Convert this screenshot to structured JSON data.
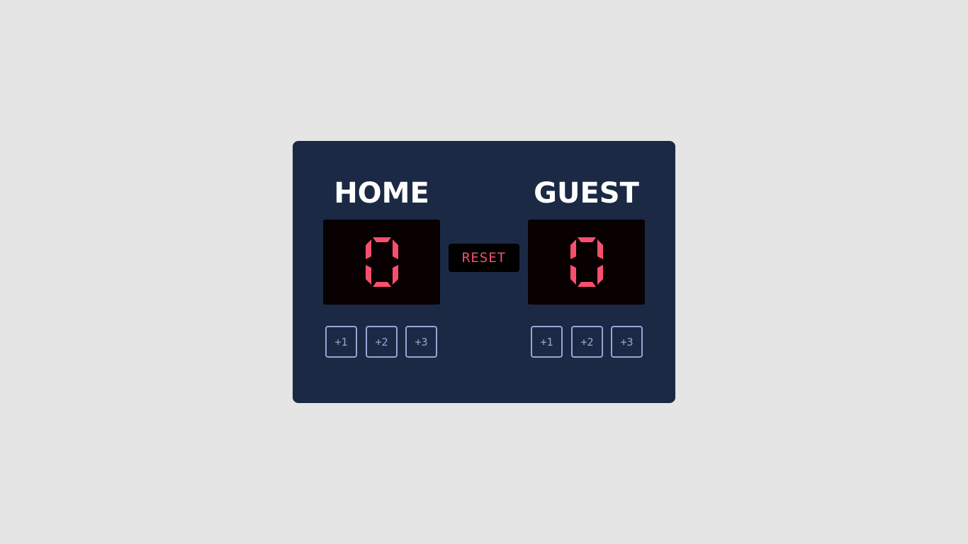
{
  "home": {
    "title": "HOME",
    "score": 0,
    "buttons": [
      "+1",
      "+2",
      "+3"
    ]
  },
  "guest": {
    "title": "GUEST",
    "score": 0,
    "buttons": [
      "+1",
      "+2",
      "+3"
    ]
  },
  "reset_label": "RESET",
  "colors": {
    "page_background": "#e5e5e5",
    "board_background": "#1b2945",
    "score_background": "#080001",
    "score_digit": "#f94f6d",
    "button_outline": "#9aa5d6",
    "title_text": "#ffffff"
  }
}
